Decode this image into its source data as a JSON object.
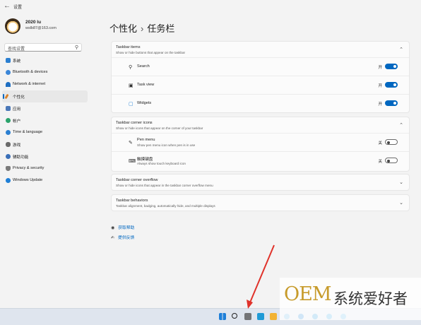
{
  "window": {
    "title": "设置",
    "back_icon": "arrow-left-icon"
  },
  "profile": {
    "name": "2020 lu",
    "email": "wslb87@163.com"
  },
  "search": {
    "placeholder": "查找设置"
  },
  "sidebar": {
    "items": [
      {
        "label": "系统",
        "icon": "monitor-icon",
        "color": "#2b7fd1",
        "active": false
      },
      {
        "label": "Bluetooth & devices",
        "icon": "bluetooth-icon",
        "color": "#3a86d8",
        "active": false
      },
      {
        "label": "Network & internet",
        "icon": "wifi-icon",
        "color": "#1f6fc2",
        "active": false
      },
      {
        "label": "个性化",
        "icon": "brush-icon",
        "color": "#d9822b",
        "active": true
      },
      {
        "label": "应用",
        "icon": "apps-icon",
        "color": "#4a78b8",
        "active": false
      },
      {
        "label": "帐户",
        "icon": "person-icon",
        "color": "#2aa36b",
        "active": false
      },
      {
        "label": "Time & language",
        "icon": "globe-clock-icon",
        "color": "#2b7fd1",
        "active": false
      },
      {
        "label": "游戏",
        "icon": "gamepad-icon",
        "color": "#6a6a6a",
        "active": false
      },
      {
        "label": "辅助功能",
        "icon": "accessibility-icon",
        "color": "#3a6fb8",
        "active": false
      },
      {
        "label": "Privacy & security",
        "icon": "shield-icon",
        "color": "#7a7a7a",
        "active": false
      },
      {
        "label": "Windows Update",
        "icon": "update-icon",
        "color": "#1f7fd6",
        "active": false
      }
    ]
  },
  "main": {
    "breadcrumb_parent": "个性化",
    "breadcrumb_sep": "›",
    "title": "任务栏",
    "taskbar_items": {
      "title": "Taskbar items",
      "subtitle": "Show or hide buttons that appear on the taskbar",
      "rows": [
        {
          "label": "Search",
          "state": "开",
          "icon": "search-icon"
        },
        {
          "label": "Task view",
          "state": "开",
          "icon": "task-view-icon"
        },
        {
          "label": "Widgets",
          "state": "开",
          "icon": "widgets-icon"
        }
      ]
    },
    "corner_icons": {
      "title": "Taskbar corner icons",
      "subtitle": "Show or hide icons that appear on the corner of your taskbar",
      "rows": [
        {
          "label": "Pen menu",
          "sub": "Show pen menu icon when pen is in use",
          "state": "关",
          "icon": "pen-icon"
        },
        {
          "label": "触摸键盘",
          "sub": "Always show touch keyboard icon",
          "state": "关",
          "icon": "keyboard-icon"
        }
      ]
    },
    "corner_overflow": {
      "title": "Taskbar corner overflow",
      "subtitle": "Show or hide icons that appear in the taskbar corner overflow menu"
    },
    "behaviors": {
      "title": "Taskbar behaviors",
      "subtitle": "Taskbar alignment, badging, automatically hide, and multiple displays"
    },
    "links": {
      "help": "获取帮助",
      "feedback": "提供反馈"
    }
  },
  "watermark": {
    "latin": "OEM",
    "chinese": "系统爱好者"
  },
  "colors": {
    "accent": "#0067c0",
    "taskbar": "#dfe5ee",
    "annotation_arrow": "#e0322a"
  }
}
